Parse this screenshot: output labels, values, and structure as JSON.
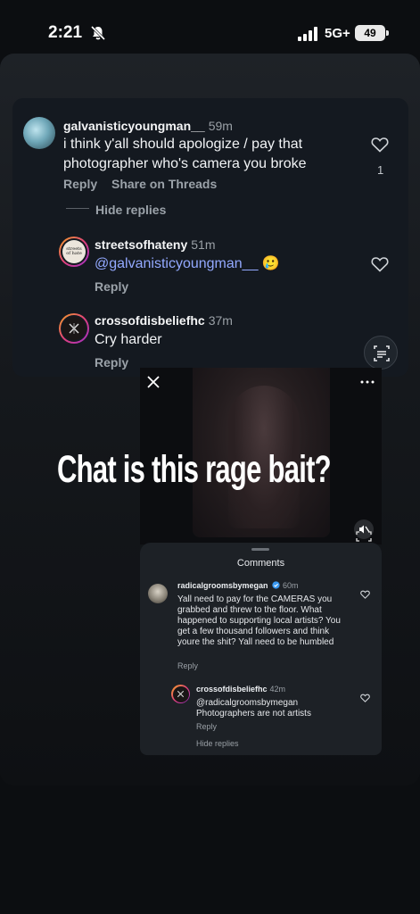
{
  "status_bar": {
    "time": "2:21",
    "network": "5G+",
    "battery": "49"
  },
  "top_comments": [
    {
      "username": "galvanisticyoungman__",
      "time": "59m",
      "text": "i think y'all should apologize / pay that photographer who's camera you broke",
      "reply": "Reply",
      "share": "Share on Threads",
      "likes": "1"
    },
    {
      "username": "streetsofhateny",
      "time": "51m",
      "mention": "@galvanisticyoungman__",
      "emoji": "🥲",
      "reply": "Reply"
    },
    {
      "username": "crossofdisbeliefhc",
      "time": "37m",
      "text": "Cry harder",
      "reply": "Reply"
    }
  ],
  "hide_replies": "Hide replies",
  "caption": "Chat is this rage bait?",
  "sheet": {
    "title": "Comments",
    "comments": [
      {
        "username": "radicalgroomsbymegan",
        "time": "60m",
        "text": "Yall need to pay for the CAMERAS you grabbed and threw to the floor. What happened to supporting local artists? You get a few thousand followers and think youre the shit? Yall need to be humbled",
        "reply": "Reply",
        "verified": true
      },
      {
        "username": "crossofdisbeliefhc",
        "time": "42m",
        "text": "@radicalgroomsbymegan Photographers are not artists",
        "reply": "Reply"
      }
    ],
    "hide_replies": "Hide replies"
  },
  "avatars": {
    "streetsofhate_badge": "streets of hate"
  },
  "icons": [
    "bell-slash-icon",
    "signal-icon",
    "heart-icon",
    "close-icon",
    "more-icon",
    "mute-icon",
    "lens-icon",
    "verified-badge-icon"
  ],
  "colors": {
    "background": "#0c0e11",
    "card": "#141920",
    "mention": "#93a9ff",
    "story_ring": "#e0417a",
    "verified": "#3897f0"
  }
}
